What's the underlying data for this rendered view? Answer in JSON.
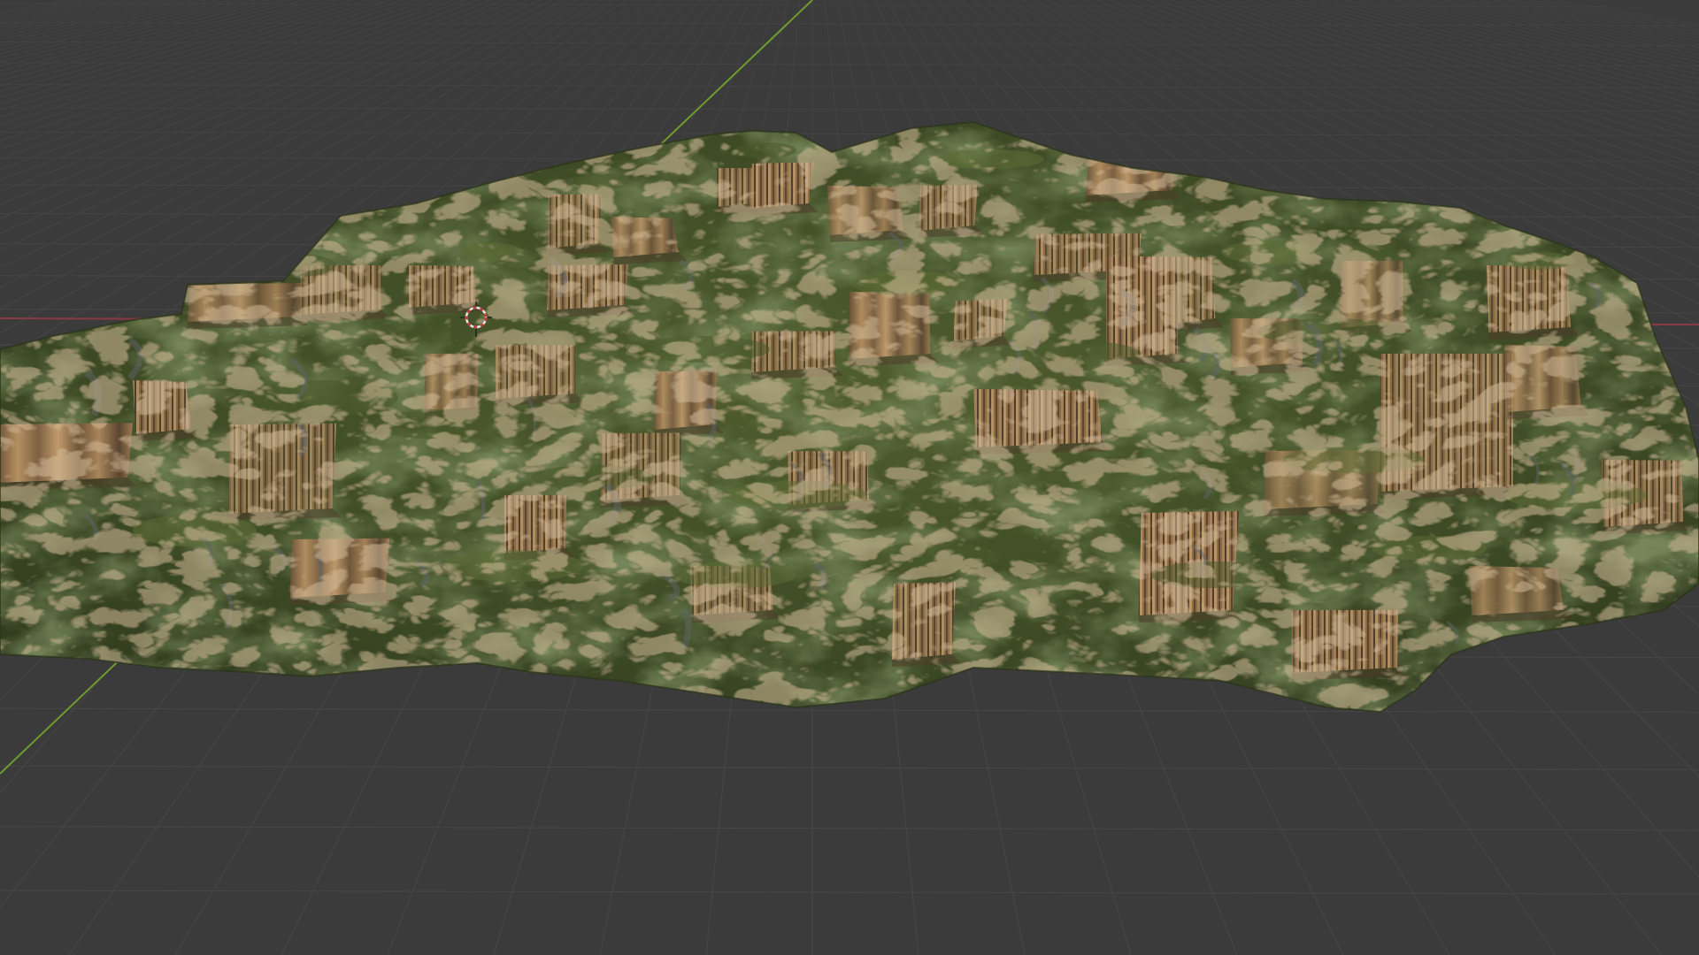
{
  "app": {
    "view": "3d-viewport",
    "shading": "material-preview"
  },
  "viewport": {
    "background_color": "#3b3b3b",
    "grid_color": "#474747",
    "x_axis_color": "#8a3a44",
    "y_axis_color": "#6f9a2e"
  },
  "scene_objects": [
    {
      "name_icon": "terrain-mesh",
      "material_colors": {
        "grass_dark": "#2f3b1f",
        "grass": "#4a5a2c",
        "grass_light": "#5d6b36",
        "cliff_light": "#b08a5e",
        "cliff_mid": "#8a6a44",
        "cliff_dark": "#4d3d2a",
        "rock_grey": "#5e6366"
      }
    }
  ],
  "cursor": {
    "icon": "3d-cursor-icon",
    "color_a": "#c43a3a",
    "color_b": "#e8e8e8"
  }
}
